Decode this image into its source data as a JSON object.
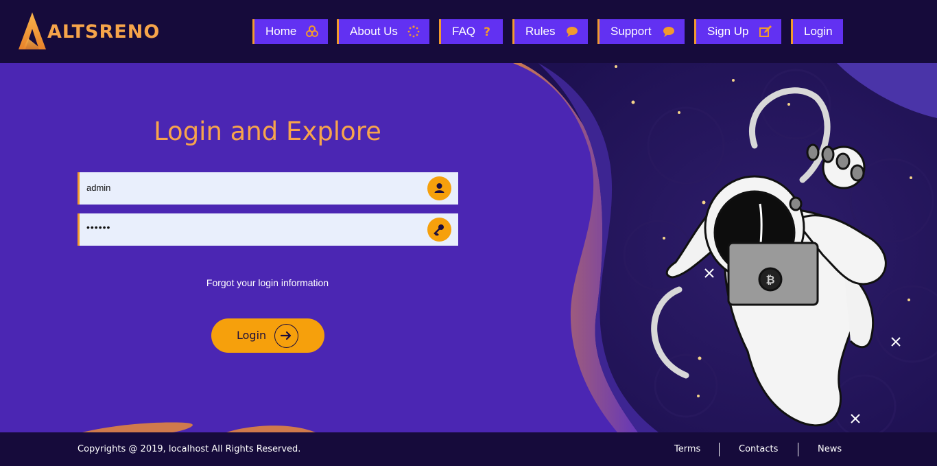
{
  "brand": {
    "name": "ALTSRENO"
  },
  "nav": {
    "items": [
      {
        "label": "Home",
        "icon": "cubes-icon"
      },
      {
        "label": "About Us",
        "icon": "spinner-icon"
      },
      {
        "label": "FAQ",
        "icon": "question-icon"
      },
      {
        "label": "Rules",
        "icon": "comment-icon"
      },
      {
        "label": "Support",
        "icon": "comment-icon"
      },
      {
        "label": "Sign Up",
        "icon": "edit-icon"
      },
      {
        "label": "Login",
        "icon": ""
      }
    ]
  },
  "login": {
    "title": "Login and Explore",
    "username_value": "admin",
    "password_value": "••••••",
    "username_icon": "user-icon",
    "password_icon": "key-icon",
    "forgot_label": "Forgot your login information",
    "button_label": "Login",
    "button_icon": "arrow-right-icon"
  },
  "footer": {
    "copyright": "Copyrights @ 2019, localhost All Rights Reserved.",
    "links": [
      "Terms",
      "Contacts",
      "News"
    ]
  },
  "colors": {
    "header_bg": "#160b3b",
    "main_bg": "#4b26b3",
    "nav_bg": "#6231f2",
    "accent": "#f29a2e",
    "button": "#f6a00c",
    "title": "#f7a44c"
  }
}
